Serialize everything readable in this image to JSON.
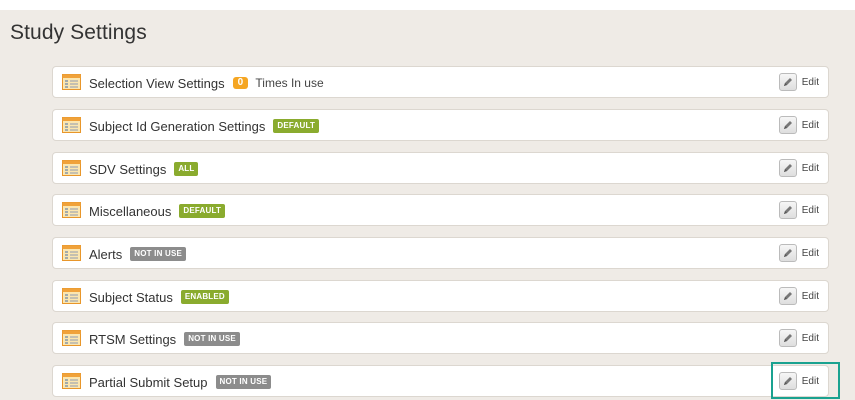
{
  "page_title": "Study Settings",
  "colors": {
    "panel_bg": "#efebe6",
    "badge_green": "#8aab2e",
    "badge_gray": "#8c8c8c",
    "badge_orange": "#f5a623",
    "highlight": "#1aa290"
  },
  "settings": [
    {
      "label": "Selection View Settings",
      "count": "0",
      "suffix": "Times In use",
      "edit": "Edit"
    },
    {
      "label": "Subject Id Generation Settings",
      "badge": "DEFAULT",
      "edit": "Edit"
    },
    {
      "label": "SDV Settings",
      "badge": "ALL",
      "edit": "Edit"
    },
    {
      "label": "Miscellaneous",
      "badge": "DEFAULT",
      "edit": "Edit"
    },
    {
      "label": "Alerts",
      "badge": "NOT IN USE",
      "edit": "Edit"
    },
    {
      "label": "Subject Status",
      "badge": "ENABLED",
      "edit": "Edit"
    },
    {
      "label": "RTSM Settings",
      "badge": "NOT IN USE",
      "edit": "Edit"
    },
    {
      "label": "Partial Submit Setup",
      "badge": "NOT IN USE",
      "edit": "Edit"
    }
  ]
}
